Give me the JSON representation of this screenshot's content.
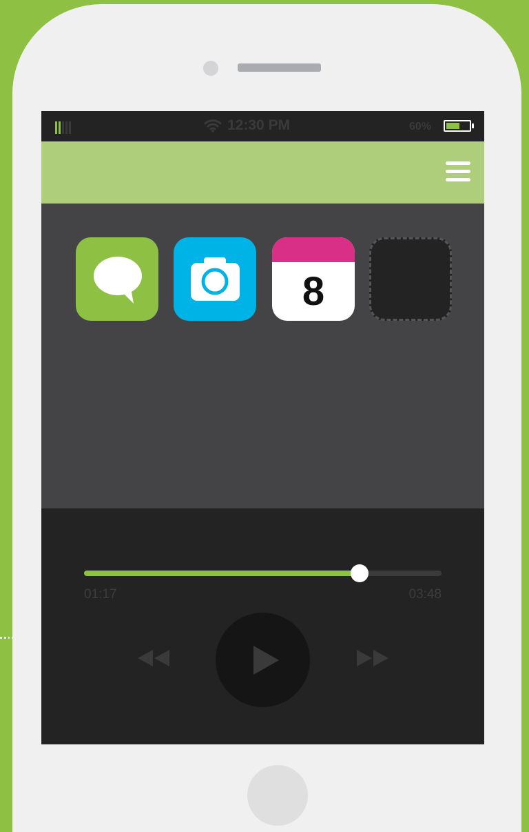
{
  "status_bar": {
    "time": "12:30 PM",
    "battery_label": "60%",
    "battery_level": 0.6,
    "signal_colors": [
      "#8dc043",
      "#8dc043",
      "#3a3a3a",
      "#3a3a3a",
      "#3a3a3a"
    ]
  },
  "header": {
    "menu_icon": "hamburger-menu-icon"
  },
  "apps": [
    {
      "name": "messages",
      "icon": "speech-bubble-icon",
      "color": "#8dc043"
    },
    {
      "name": "camera",
      "icon": "camera-icon",
      "color": "#00b3e6"
    },
    {
      "name": "calendar",
      "icon": "calendar-icon",
      "color": "#d92f86",
      "day": "8"
    },
    {
      "name": "empty-slot",
      "icon": "dashed-placeholder",
      "color": "#232323"
    }
  ],
  "player": {
    "elapsed": "01:17",
    "total": "03:48",
    "progress": 0.77,
    "controls": [
      "rewind-icon",
      "play-icon",
      "fast-forward-icon"
    ]
  },
  "colors": {
    "accent": "#8dc043",
    "header": "#afce7b",
    "screen": "#444446",
    "dark": "#232323"
  }
}
